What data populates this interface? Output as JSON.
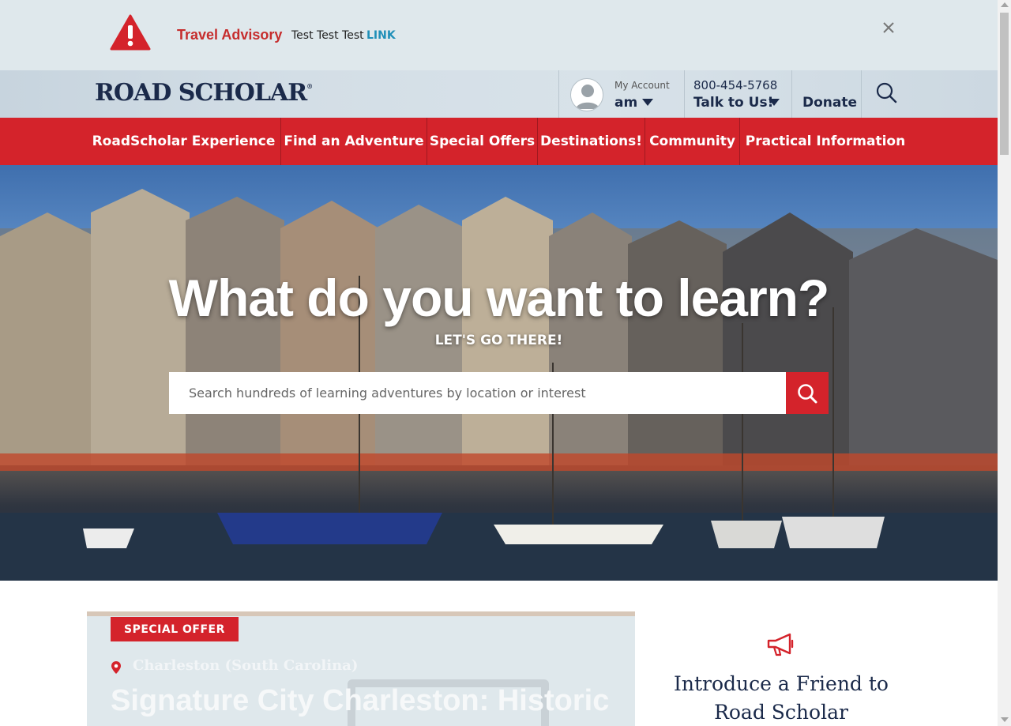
{
  "advisory": {
    "title": "Travel Advisory",
    "text": "Test Test Test",
    "link_label": "LINK",
    "icon": "warning-icon",
    "close_icon": "close-icon"
  },
  "header": {
    "logo_text": "ROAD SCHOLAR",
    "logo_mark": "®",
    "account_label": "My Account",
    "account_name": "am",
    "phone": "800-454-5768",
    "talk_label": "Talk to Us!",
    "donate_label": "Donate",
    "search_icon": "search-icon"
  },
  "nav": {
    "items": [
      {
        "label": "RoadScholar Experience"
      },
      {
        "label": "Find an Adventure"
      },
      {
        "label": "Special Offers"
      },
      {
        "label": "Destinations!"
      },
      {
        "label": "Community"
      },
      {
        "label": "Practical Information"
      }
    ]
  },
  "hero": {
    "title": "What do you want to learn?",
    "subtitle": "LET'S GO THERE!",
    "search_placeholder": "Search hundreds of learning adventures by location or interest"
  },
  "offer_card": {
    "badge": "SPECIAL OFFER",
    "location": "Charleston (South Carolina)",
    "title": "Signature City Charleston: Historic"
  },
  "sidebar_promo": {
    "title": "Introduce a Friend to Road Scholar",
    "icon": "megaphone-icon"
  },
  "colors": {
    "brand_red": "#d4232b",
    "navy": "#1b2a4a",
    "advisory_bg": "#dfe8ec",
    "link_blue": "#1f8fb8"
  }
}
